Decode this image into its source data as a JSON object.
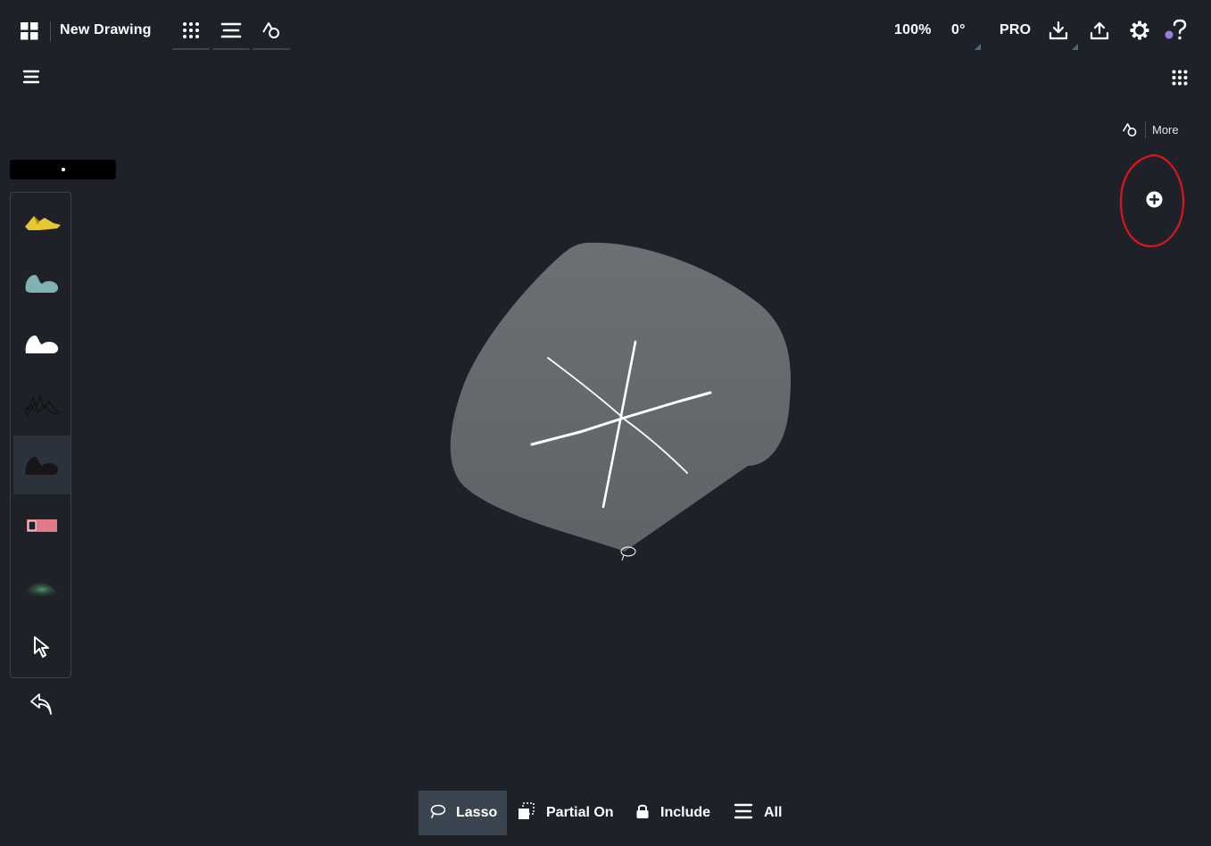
{
  "topbar": {
    "title": "New Drawing",
    "zoom": "100%",
    "rotation": "0°",
    "pro_label": "PRO"
  },
  "right_panel": {
    "more_label": "More"
  },
  "bottombar": {
    "lasso_label": "Lasso",
    "partial_label": "Partial On",
    "include_label": "Include",
    "all_label": "All"
  },
  "brushes": [
    {
      "name": "marker",
      "color": "#e8c830"
    },
    {
      "name": "watercolor",
      "color": "#7fb2b0"
    },
    {
      "name": "ink",
      "color": "#ffffff"
    },
    {
      "name": "charcoal",
      "color": "#222222"
    },
    {
      "name": "pen",
      "color": "#1a1a1a"
    },
    {
      "name": "eraser",
      "color": "#e07a88"
    },
    {
      "name": "airbrush",
      "color": "#3d7a55"
    },
    {
      "name": "select",
      "color": "#ffffff"
    }
  ],
  "colors": {
    "background": "#1e2228",
    "shape_fill": "#6b6f73",
    "annotation_circle": "#e0141e",
    "accent_dot": "#9b7fe0"
  }
}
